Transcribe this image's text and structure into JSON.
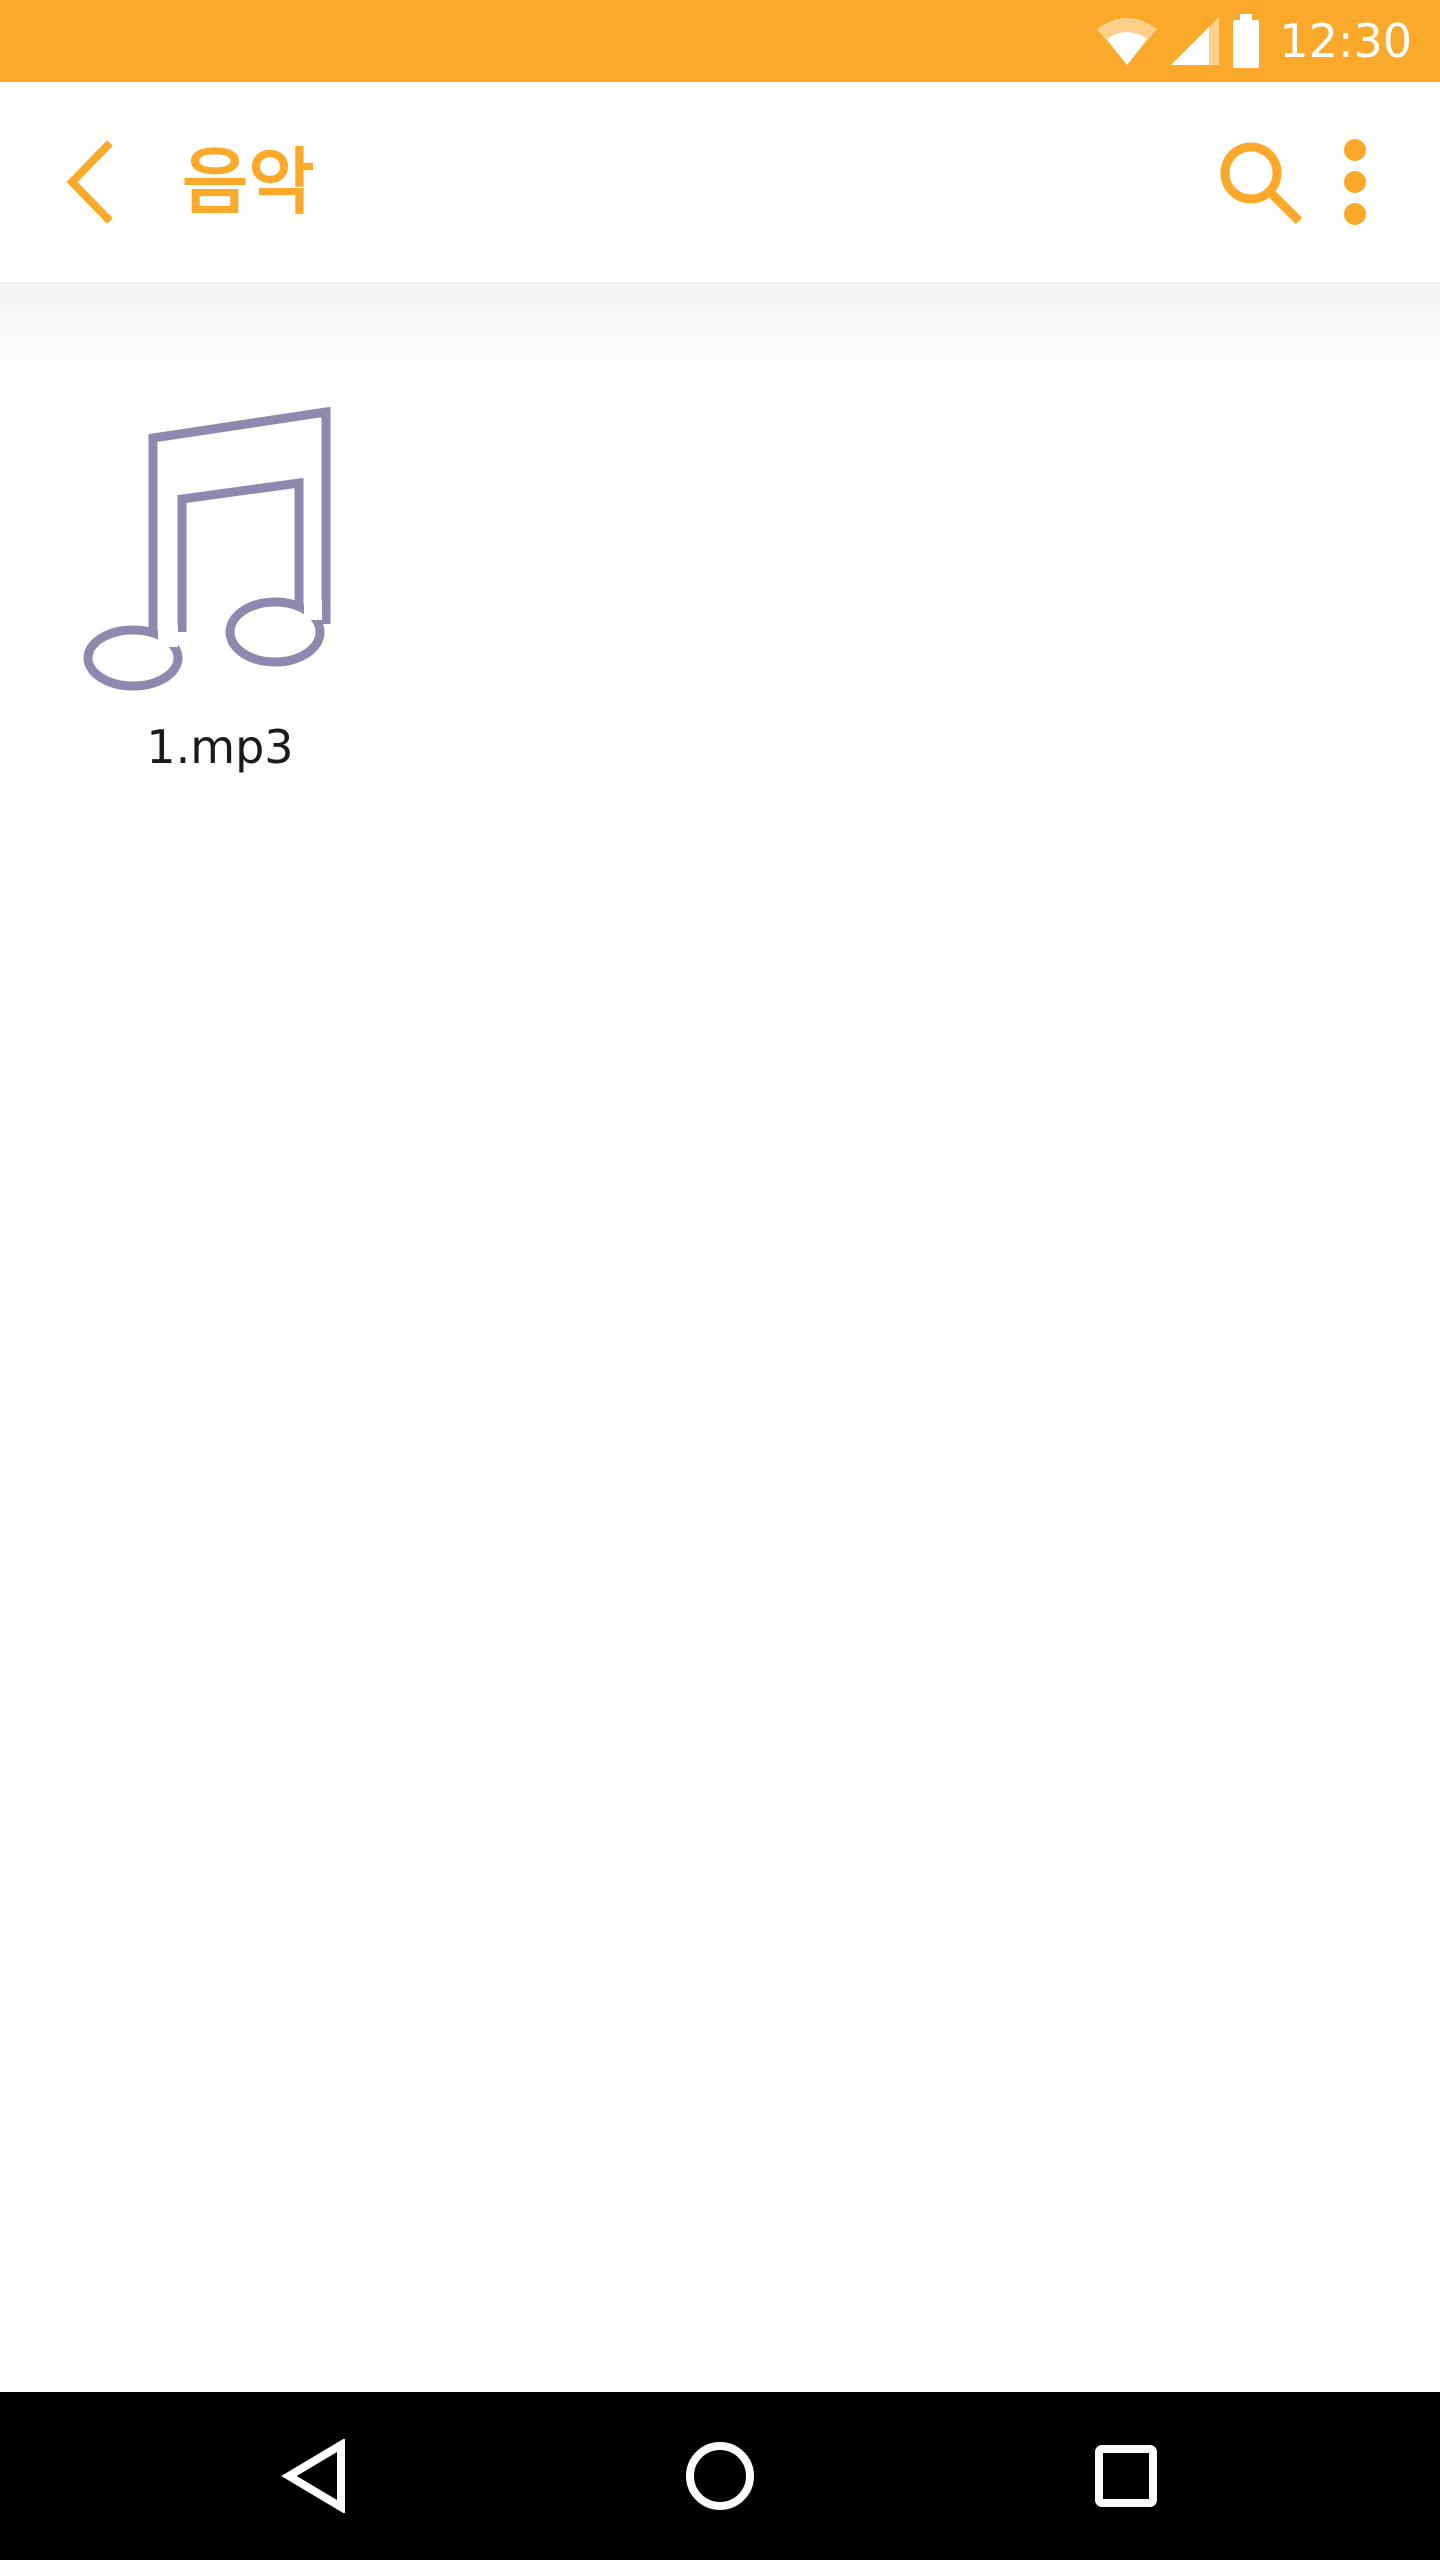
{
  "status_bar": {
    "time": "12:30",
    "icons": [
      "wifi-icon",
      "cellular-signal-icon",
      "battery-icon"
    ],
    "background_color": "#FBA92A"
  },
  "app_bar": {
    "title": "음악",
    "back_icon": "chevron-left-icon",
    "search_icon": "search-icon",
    "overflow_icon": "more-vertical-icon",
    "accent_color": "#FBA92A"
  },
  "files": [
    {
      "name": "1.mp3",
      "icon": "music-note-icon",
      "icon_color": "#8E8AAF"
    }
  ],
  "nav_bar": {
    "buttons": [
      "back-triangle-icon",
      "home-circle-icon",
      "recents-square-icon"
    ],
    "background_color": "#000000"
  }
}
